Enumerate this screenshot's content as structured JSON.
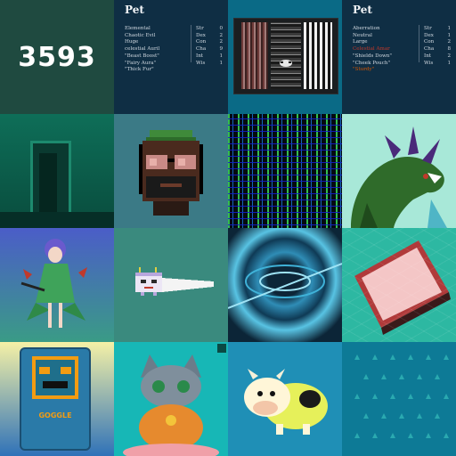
{
  "tiles": {
    "number": {
      "value": "3593"
    },
    "pet_card_1": {
      "title": "Pet",
      "traits": [
        "Elemental",
        "Chaotic Evil",
        "Huge",
        "celestial Auril",
        "\"Beast Boost\"",
        "\"Fairy Aura\"",
        "\"Thick Fur\""
      ],
      "stats": [
        {
          "name": "Str",
          "value": "0"
        },
        {
          "name": "Dex",
          "value": "2"
        },
        {
          "name": "Con",
          "value": "2"
        },
        {
          "name": "Cha",
          "value": "9"
        },
        {
          "name": "Int",
          "value": "1"
        },
        {
          "name": "Wis",
          "value": "1"
        }
      ]
    },
    "pet_card_2": {
      "title": "Pet",
      "traits": [
        "Aberration",
        "Neutral",
        "Large",
        "Celestial Amar",
        "\"Shields Down\"",
        "\"Cheek Pouch\"",
        "\"Sturdy\""
      ],
      "trait_colors": [
        "#d0d8e0",
        "#d0d8e0",
        "#d0d8e0",
        "#c0392b",
        "#d0d8e0",
        "#d0d8e0",
        "#d35400"
      ],
      "stats": [
        {
          "name": "Str",
          "value": "1"
        },
        {
          "name": "Dex",
          "value": "1"
        },
        {
          "name": "Con",
          "value": "2"
        },
        {
          "name": "Cha",
          "value": "8"
        },
        {
          "name": "Int",
          "value": "2"
        },
        {
          "name": "Wis",
          "value": "1"
        }
      ]
    },
    "goggle_card": {
      "label": "GOGGLE"
    }
  },
  "colors": {
    "pet_card_bg": "#0f2e44",
    "number_bg": "#1f4a40",
    "art_bg": "#0a6a86",
    "accent_red": "#c0392b",
    "accent_orange": "#d35400"
  }
}
